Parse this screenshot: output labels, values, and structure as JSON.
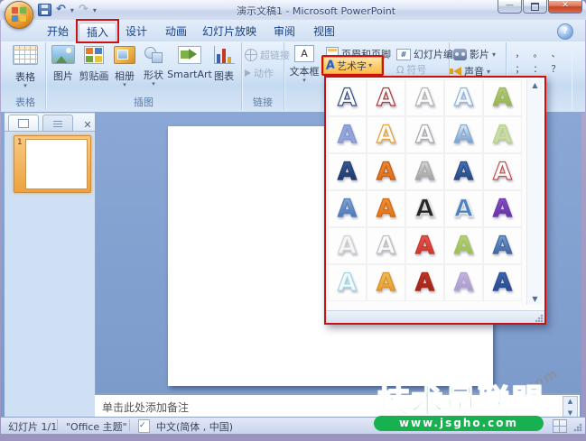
{
  "window": {
    "title": "演示文稿1 - Microsoft PowerPoint"
  },
  "icons": {
    "undo": "↶",
    "redo": "↷",
    "dropdown": "▾",
    "close": "✕",
    "min": "—",
    "help": "?",
    "omega": "Ω",
    "check": "✓",
    "up_arrow": "▲",
    "down_arrow": "▼",
    "wordart_a": "A",
    "textbox_a": "A",
    "hash": "#"
  },
  "tabs": [
    {
      "label": "开始"
    },
    {
      "label": "插入",
      "active": true
    },
    {
      "label": "设计"
    },
    {
      "label": "动画"
    },
    {
      "label": "幻灯片放映"
    },
    {
      "label": "审阅"
    },
    {
      "label": "视图"
    }
  ],
  "ribbon": {
    "groups": [
      {
        "label": "表格",
        "buttons": [
          {
            "label": "表格"
          }
        ]
      },
      {
        "label": "插图",
        "buttons": [
          {
            "label": "图片"
          },
          {
            "label": "剪贴画"
          },
          {
            "label": "相册"
          },
          {
            "label": "形状"
          },
          {
            "label": "SmartArt"
          },
          {
            "label": "图表"
          }
        ]
      },
      {
        "label": "链接",
        "buttons": [
          {
            "label": "超链接"
          },
          {
            "label": "动作"
          }
        ]
      },
      {
        "buttons": [
          {
            "label": "文本框"
          },
          {
            "label": "页眉和页脚"
          },
          {
            "label": "艺术字"
          },
          {
            "label": "幻灯片编号"
          },
          {
            "label": "符号"
          }
        ]
      },
      {
        "buttons": [
          {
            "label": "影片"
          },
          {
            "label": "声音"
          }
        ]
      },
      {
        "symbols": [
          "，",
          "。",
          "、",
          "；",
          "：",
          "？"
        ]
      }
    ]
  },
  "wordart_gallery": {
    "letter": "A",
    "styles": [
      {
        "f": "#ffffff",
        "s": "#33518a"
      },
      {
        "f": "#ffffff",
        "s": "#b03a3a"
      },
      {
        "f": "#fcfcfc",
        "s": "#b5b5b5"
      },
      {
        "f": "#f4f8fd",
        "s": "#8fb4dc"
      },
      {
        "g": [
          "#b6cf78",
          "#8fae4a"
        ],
        "s": "#9cb85a"
      },
      {
        "f": "#93a5da",
        "s": "#8093cd"
      },
      {
        "f": "#fffaf2",
        "s": "#e3a23e"
      },
      {
        "f": "#fbfbfb",
        "s": "#aaaaaa"
      },
      {
        "g": [
          "#eef4fb",
          "#5a8ac2"
        ],
        "s": "#87a9cf"
      },
      {
        "f": "#cbdda6",
        "s": "#b9cf8c"
      },
      {
        "g": [
          "#3c5f9e",
          "#18305e"
        ],
        "s": "#25406f"
      },
      {
        "g": [
          "#f0873a",
          "#d96a14"
        ],
        "s": "#c75f10"
      },
      {
        "g": [
          "#d9d9d9",
          "#969696"
        ],
        "s": "#a8a8a8"
      },
      {
        "g": [
          "#4a79bd",
          "#1d3f79"
        ],
        "s": "#2c4e85"
      },
      {
        "f": "#ffffff",
        "s": "#c94f4f"
      },
      {
        "g": [
          "#89abdc",
          "#3e6cb0"
        ],
        "s": "#597fb8"
      },
      {
        "g": [
          "#f0943f",
          "#dd6f12"
        ],
        "s": "#cf6a14"
      },
      {
        "f": "#262626",
        "s": "#dcdcdc"
      },
      {
        "f": "#4f81bd",
        "s": "#e8eef6"
      },
      {
        "g": [
          "#8a53c4",
          "#5f2a9e"
        ],
        "s": "#6f3cae"
      },
      {
        "f": "#f5f5f5",
        "s": "#d0d0d0"
      },
      {
        "f": "#fafafa",
        "s": "#bdbdbd"
      },
      {
        "g": [
          "#ea5a50",
          "#cf2e24"
        ],
        "s": "#c23a30"
      },
      {
        "g": [
          "#b8d578",
          "#94b84e"
        ],
        "s": "#a4c261"
      },
      {
        "g": [
          "#7ba3d9",
          "#2f5b9d"
        ],
        "s": "#44699f"
      },
      {
        "f": "#f3fafc",
        "s": "#a6d6e4"
      },
      {
        "g": [
          "#f6c254",
          "#e2922b"
        ],
        "s": "#d5922e"
      },
      {
        "g": [
          "#c43a2a",
          "#951f14"
        ],
        "s": "#a82a1c"
      },
      {
        "g": [
          "#c4b8de",
          "#a493cc"
        ],
        "s": "#b2a3d4"
      },
      {
        "g": [
          "#3f69b4",
          "#24458a"
        ],
        "s": "#2e4f92"
      }
    ]
  },
  "slides_panel": {
    "number": "1"
  },
  "notes": {
    "placeholder": "单击此处添加备注"
  },
  "status_bar": {
    "slide_indicator": "幻灯片 1/1",
    "theme": "\"Office 主题\"",
    "language": "中文(简体 , 中国)"
  },
  "watermark": {
    "title": "技术员联盟",
    "url": "www.jsgho.com",
    "faded": ".com"
  },
  "colors": {
    "annotation": "#cc1111",
    "watermark_green": "#17b24f",
    "selection_orange": "#fdba45"
  }
}
